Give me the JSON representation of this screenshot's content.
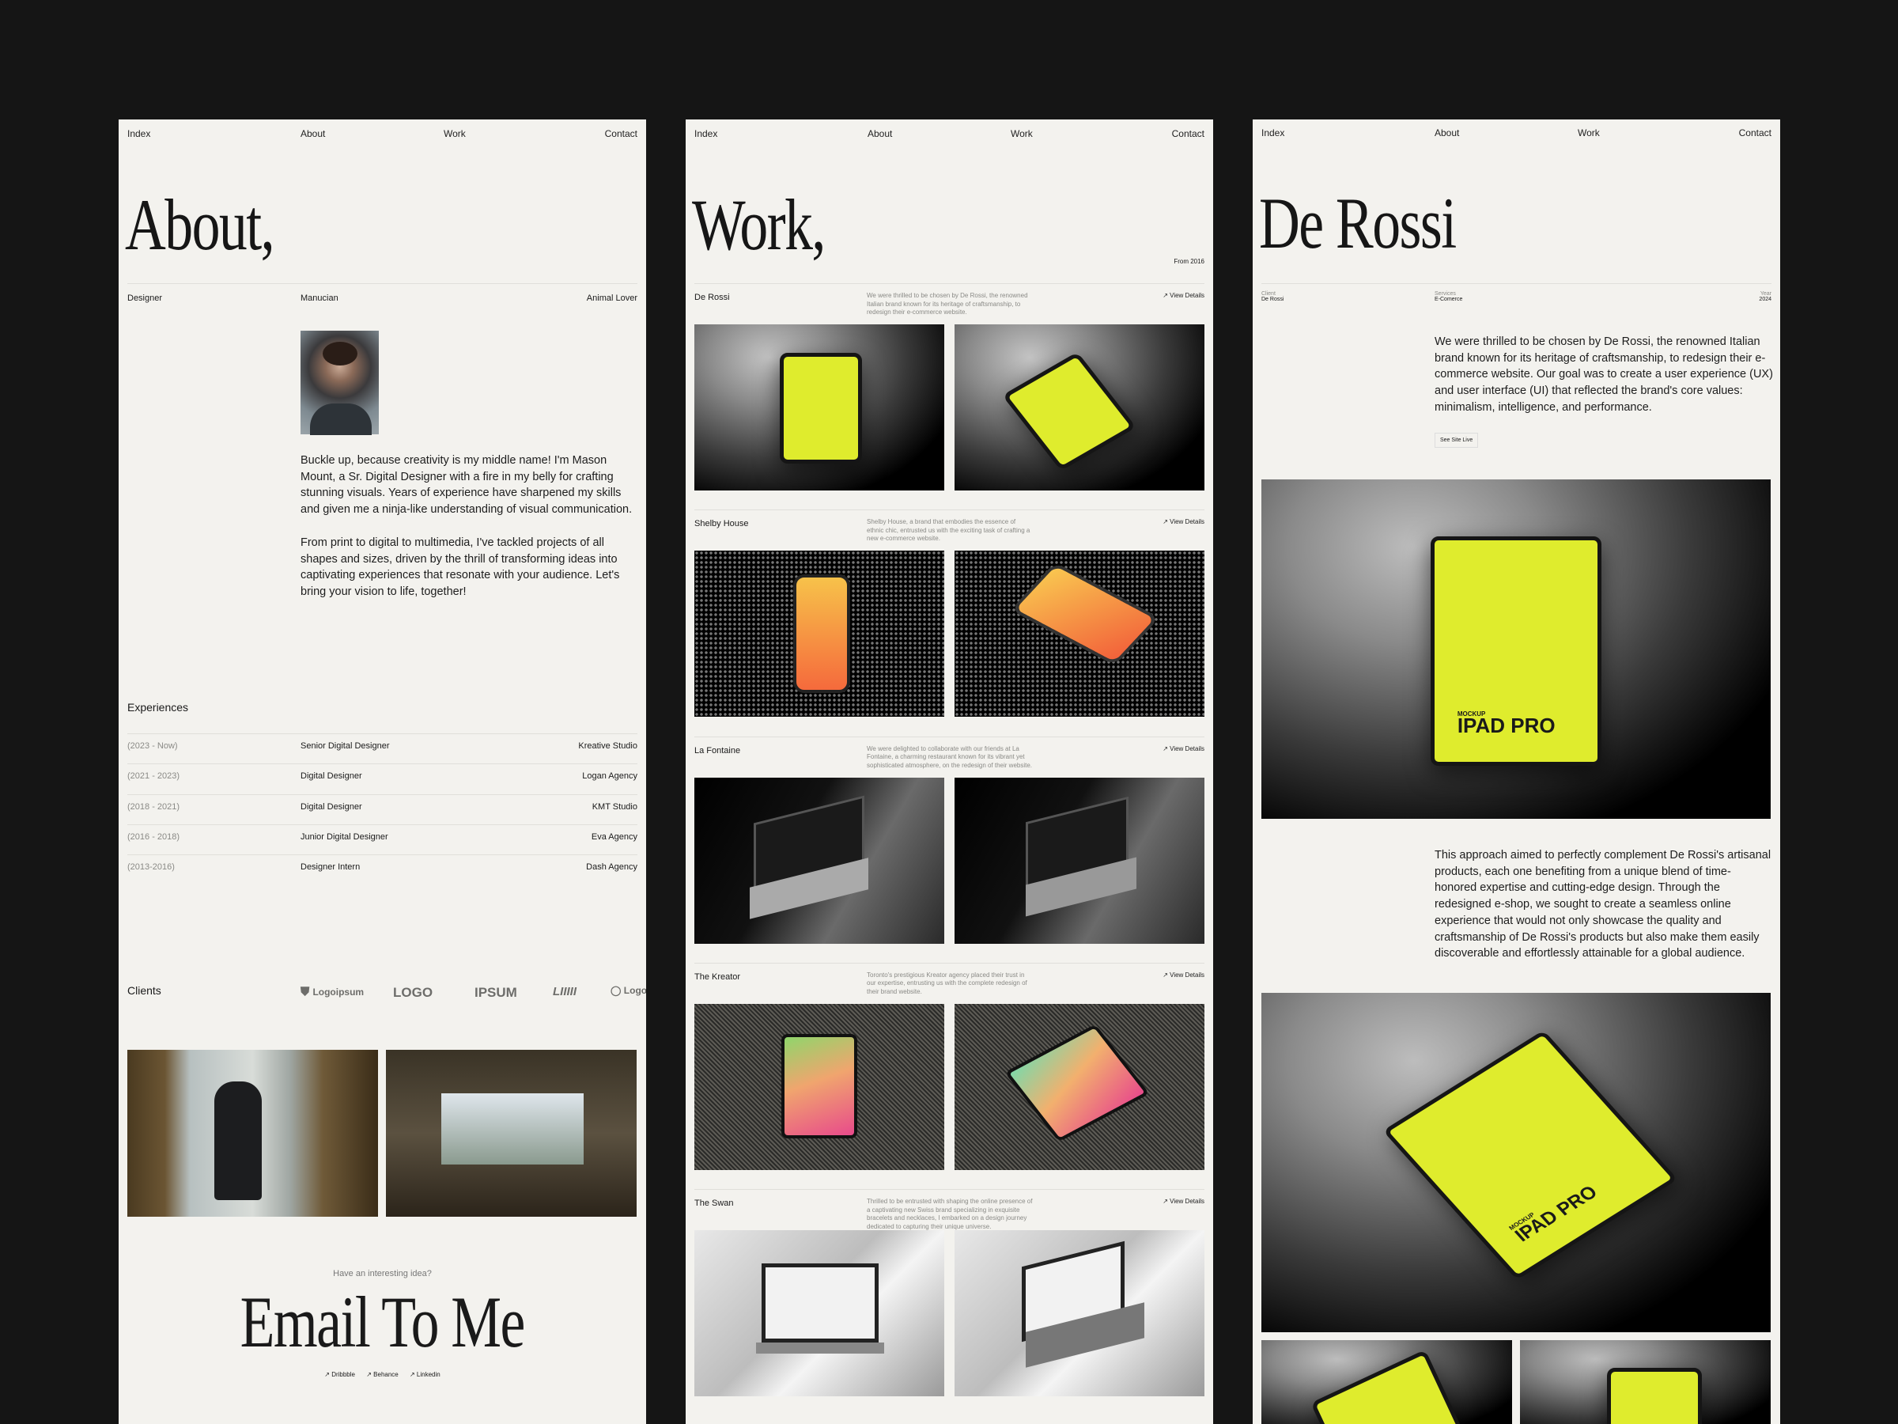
{
  "nav": {
    "index": "Index",
    "about": "About",
    "work": "Work",
    "contact": "Contact"
  },
  "about": {
    "title": "About,",
    "tags": [
      "Designer",
      "Manucian",
      "Animal Lover"
    ],
    "bio": [
      "Buckle up, because creativity is my middle name! I'm Mason Mount, a Sr. Digital Designer with a fire in my belly for crafting stunning visuals. Years of experience have sharpened my skills and given me a ninja-like understanding of visual communication.",
      "From print to digital to multimedia, I've tackled projects of all shapes and sizes, driven by the thrill of transforming ideas into captivating experiences that resonate with your audience. Let's bring your vision to life, together!"
    ],
    "experiences_heading": "Experiences",
    "experiences": [
      {
        "period": "(2023 - Now)",
        "role": "Senior Digital Designer",
        "company": "Kreative Studio"
      },
      {
        "period": "(2021 - 2023)",
        "role": "Digital Designer",
        "company": "Logan Agency"
      },
      {
        "period": "(2018 - 2021)",
        "role": "Digital Designer",
        "company": "KMT Studio"
      },
      {
        "period": "(2016 - 2018)",
        "role": "Junior Digital Designer",
        "company": "Eva Agency"
      },
      {
        "period": "(2013-2016)",
        "role": "Designer Intern",
        "company": "Dash Agency"
      }
    ],
    "clients_heading": "Clients",
    "clients": [
      "Logoipsum",
      "LOGO",
      "IPSUM",
      "LIIIII",
      "Logo"
    ],
    "cta_prompt": "Have an interesting idea?",
    "cta_title": "Email To Me",
    "social": [
      "Dribbble",
      "Behance",
      "Linkedin"
    ]
  },
  "work": {
    "title": "Work,",
    "since": "From 2016",
    "view_details": "View Details",
    "projects": [
      {
        "name": "De Rossi",
        "desc": "We were thrilled to be chosen by De Rossi, the renowned Italian brand known for its heritage of craftsmanship, to redesign their e-commerce website."
      },
      {
        "name": "Shelby House",
        "desc": "Shelby House, a brand that embodies the essence of ethnic chic, entrusted us with the exciting task of crafting a new e-commerce website."
      },
      {
        "name": "La Fontaine",
        "desc": "We were delighted to collaborate with our friends at La Fontaine, a charming restaurant known for its vibrant yet sophisticated atmosphere, on the redesign of their website."
      },
      {
        "name": "The Kreator",
        "desc": "Toronto's prestigious Kreator agency placed their trust in our expertise, entrusting us with the complete redesign of their brand website."
      },
      {
        "name": "The Swan",
        "desc": "Thrilled to be entrusted with shaping the online presence of a captivating new Swiss brand specializing in exquisite bracelets and necklaces, I embarked on a design journey dedicated to capturing their unique universe."
      }
    ]
  },
  "detail": {
    "title": "De Rossi",
    "meta": [
      {
        "label": "Client",
        "value": "De Rossi"
      },
      {
        "label": "Services",
        "value": "E-Comerce"
      },
      {
        "label": "Year",
        "value": "2024"
      }
    ],
    "intro": "We were thrilled to be chosen by De Rossi, the renowned Italian brand known for its heritage of craftsmanship, to redesign their e-commerce website.  Our goal was to create a user experience (UX) and user interface (UI) that reflected the brand's core values: minimalism, intelligence, and performance.",
    "site_button": "See Site Live",
    "body": "This approach aimed to perfectly complement De Rossi's artisanal products, each one benefiting from a unique blend of time-honored expertise and cutting-edge design.  Through the redesigned e-shop, we sought to create a seamless online experience that would not only showcase the quality and craftsmanship of De Rossi's products but also make them easily discoverable and effortlessly attainable for a global audience.",
    "mockup_label": "IPAD PRO",
    "mockup_sub": "MOCKUP"
  },
  "colors": {
    "background": "#151515",
    "panel": "#f3f2ee",
    "accent": "#dfec2d"
  }
}
